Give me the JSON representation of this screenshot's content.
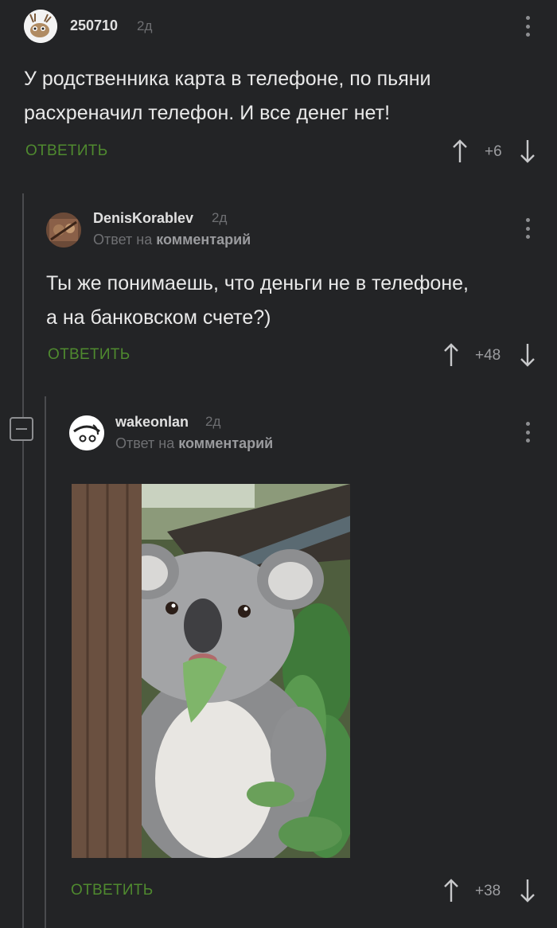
{
  "comments": [
    {
      "username": "250710",
      "time": "2д",
      "text_lines": [
        "У родственника карта в телефоне, по пьяни",
        "расхреначил телефон. И все денег нет!"
      ],
      "reply_label": "ОТВЕТИТЬ",
      "votes": "+6"
    },
    {
      "username": "DenisKorablev",
      "time": "2д",
      "reply_prefix": "Ответ на",
      "reply_target": "комментарий",
      "text_lines": [
        "Ты же понимаешь, что деньги не в телефоне,",
        "а на банковском счете?)"
      ],
      "reply_label": "ОТВЕТИТЬ",
      "votes": "+48"
    },
    {
      "username": "wakeonlan",
      "time": "2д",
      "reply_prefix": "Ответ на",
      "reply_target": "комментарий",
      "reply_label": "ОТВЕТИТЬ",
      "votes": "+38"
    }
  ],
  "colors": {
    "background": "#232426",
    "reply_green": "#4f8a2f",
    "thread_line": "#4a4b4e"
  },
  "icons": [
    "kebab-menu-icon",
    "arrow-up-icon",
    "arrow-down-icon",
    "collapse-minus-icon"
  ]
}
